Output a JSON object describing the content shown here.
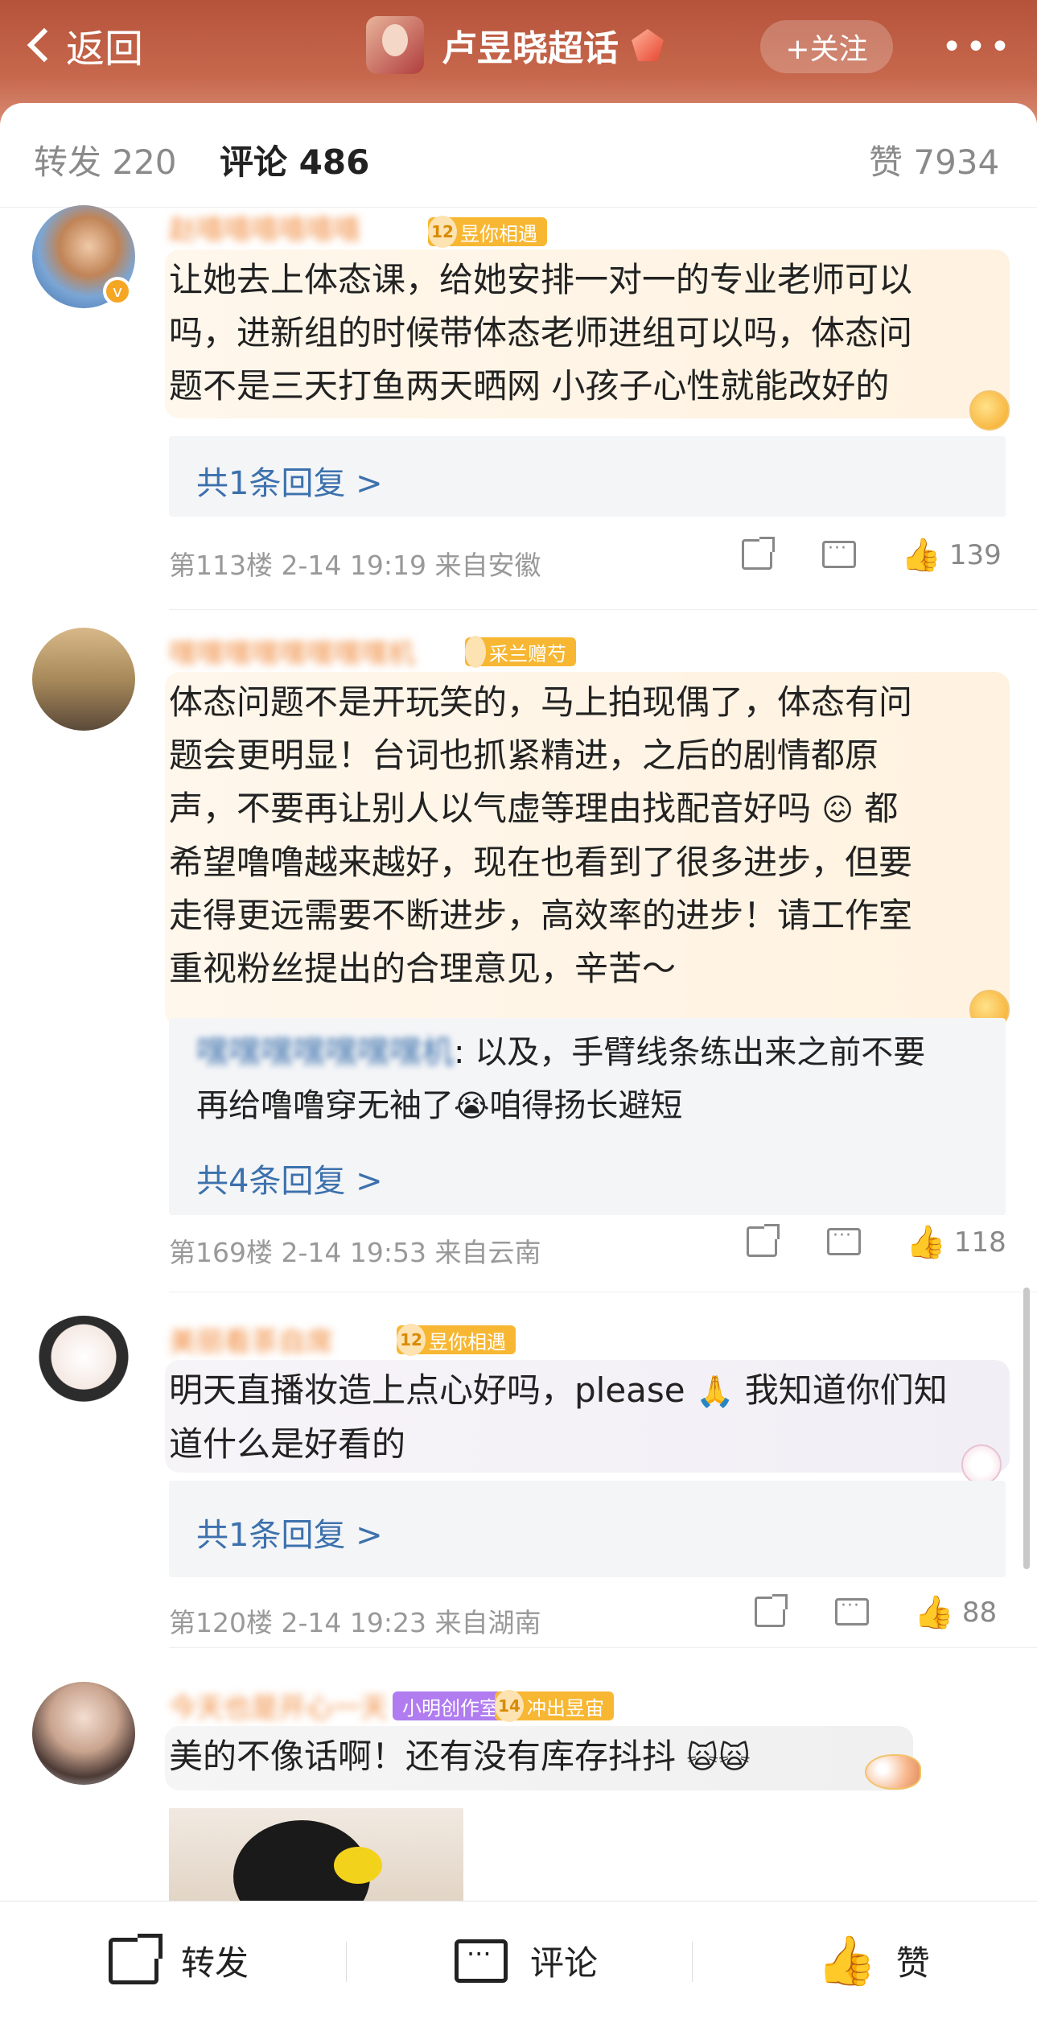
{
  "header": {
    "back_label": "返回",
    "title": "卢昱晓超话",
    "follow_label": "+关注",
    "more_label": "•••"
  },
  "tabs": {
    "repost": "转发 220",
    "comment": "评论 486",
    "like": "赞 7934"
  },
  "comments": [
    {
      "username": "赵嘻嘻嘻嘻嘻嘻",
      "badge_level": "12",
      "badge_text": "昱你相遇",
      "lines": [
        "让她去上体态课，给她安排一对一的专业老师可以",
        "吗，进新组的时候带体态老师进组可以吗，体态问",
        "题不是三天打鱼两天晒网 小孩子心性就能改好的"
      ],
      "reply_link": "共1条回复 >",
      "meta": "第113楼 2-14 19:19 来自安徽",
      "likes": "139"
    },
    {
      "username": "嘿嘿嘿嘿嘿嘿嘿嘿机",
      "badge_level": "",
      "badge_text": "采兰赠芍",
      "lines": [
        "体态问题不是开玩笑的，马上拍现偶了，体态有问",
        "题会更明显！台词也抓紧精进，之后的剧情都原",
        "声，不要再让别人以气虚等理由找配音好吗",
        "希望噜噜越来越好，现在也看到了很多进步，但要",
        "走得更远需要不断进步，高效率的进步！请工作室",
        "重视粉丝提出的合理意见，辛苦～"
      ],
      "line3_tail": "都",
      "reply_name": "嘿嘿嘿嘿嘿嘿嘿机",
      "reply_text_1": ": 以及，手臂线条练出来之前不要",
      "reply_text_2a": "再给噜噜穿无袖了",
      "reply_text_2b": "咱得扬长避短",
      "reply_link": "共4条回复 >",
      "meta": "第169楼 2-14 19:53 来自云南",
      "likes": "118"
    },
    {
      "username": "美丽看茶自席",
      "badge_level": "12",
      "badge_text": "昱你相遇",
      "line1a": "明天直播妆造上点心好吗，please",
      "line1b": "我知道你们知",
      "line2": "道什么是好看的",
      "reply_link": "共1条回复 >",
      "meta": "第120楼 2-14 19:23 来自湖南",
      "likes": "88"
    },
    {
      "username": "今天也是开心一天",
      "badge_text_a": "小明创作室",
      "badge_level": "14",
      "badge_text": "冲出昱宙",
      "line1": "美的不像话啊！还有没有库存抖抖"
    }
  ],
  "bottom_bar": {
    "share": "转发",
    "comment": "评论",
    "like": "赞"
  },
  "icons": {
    "verify": "v"
  }
}
